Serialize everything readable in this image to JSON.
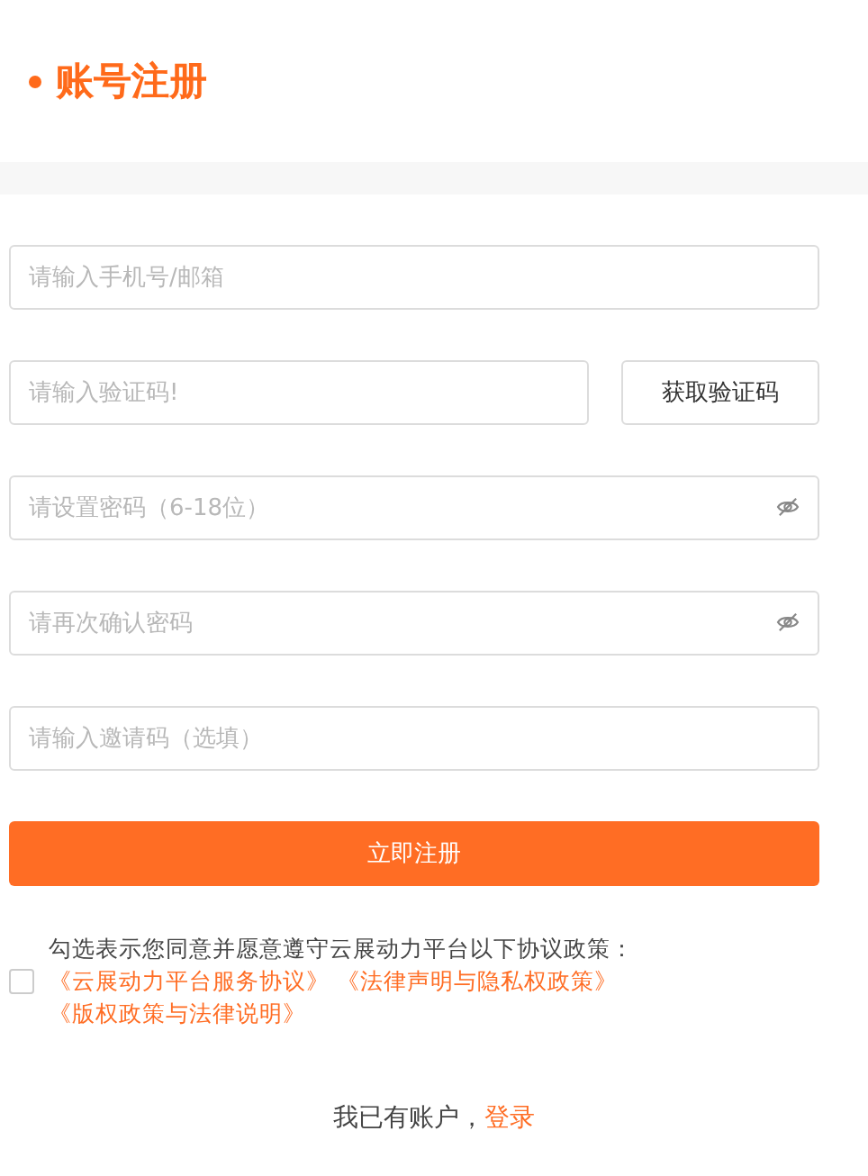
{
  "title": "账号注册",
  "fields": [
    {
      "kind": "text",
      "placeholder": "请输入手机号/邮箱"
    },
    {
      "kind": "code",
      "placeholder": "请输入验证码!",
      "button": "获取验证码"
    },
    {
      "kind": "password",
      "placeholder": "请设置密码（6-18位）"
    },
    {
      "kind": "password",
      "placeholder": "请再次确认密码"
    },
    {
      "kind": "text",
      "placeholder": "请输入邀请码（选填）"
    }
  ],
  "submit": "立即注册",
  "agreement": {
    "checked": false,
    "text": "勾选表示您同意并愿意遵守云展动力平台以下协议政策：",
    "links": [
      "《云展动力平台服务协议》",
      "《法律声明与隐私权政策》",
      "《版权政策与法律说明》"
    ]
  },
  "footer": {
    "text": "我已有账户，",
    "link": "登录"
  }
}
